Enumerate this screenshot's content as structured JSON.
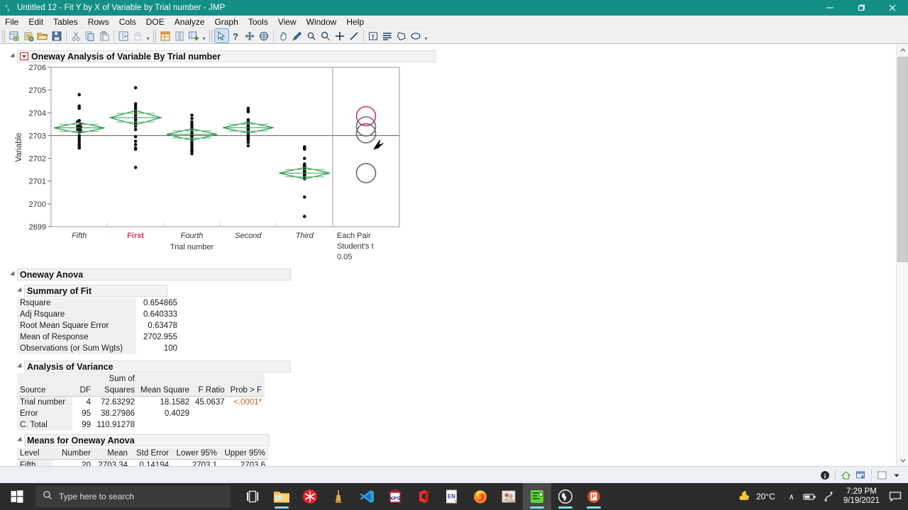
{
  "window": {
    "title": "Untitled 12 - Fit Y by X of Variable by Trial number - JMP",
    "app_icon": "jmp-icon",
    "minimize": "—",
    "maximize": "❐",
    "close": "✕",
    "accent_color": "#148f86"
  },
  "menubar": {
    "items": [
      "File",
      "Edit",
      "Tables",
      "Rows",
      "Cols",
      "DOE",
      "Analyze",
      "Graph",
      "Tools",
      "View",
      "Window",
      "Help"
    ]
  },
  "toolbar": {
    "groups": [
      [
        "new-data-table-icon",
        "new-script-icon",
        "open-icon",
        "save-icon"
      ],
      [
        "cut-icon",
        "copy-icon",
        "paste-icon"
      ],
      [
        "journal-icon",
        "lock-icon"
      ],
      [
        "report-icon",
        "column-icon",
        "add-columns-icon"
      ],
      [
        "arrow-tool-icon",
        "question-tool-icon",
        "crosshair-tool-icon",
        "brush-tool-icon"
      ],
      [
        "hand-tool-icon",
        "magic-wand-icon",
        "magnifier-small-icon",
        "magnifier-icon",
        "crosshairs-icon",
        "line-tool-icon"
      ],
      [
        "text-annotate-icon",
        "simple-shape-icon",
        "polygon-icon",
        "ellipse-icon"
      ]
    ]
  },
  "report": {
    "main_title": "Oneway Analysis of Variable By Trial number",
    "sections": {
      "oneway_anova": "Oneway Anova",
      "summary_of_fit": "Summary of Fit",
      "analysis_of_variance": "Analysis of Variance",
      "means_for_oneway_anova": "Means for Oneway Anova"
    },
    "summary_of_fit": {
      "rows": [
        {
          "label": "Rsquare",
          "value": "0.654865"
        },
        {
          "label": "Adj Rsquare",
          "value": "0.640333"
        },
        {
          "label": "Root Mean Square Error",
          "value": "0.63478"
        },
        {
          "label": "Mean of Response",
          "value": "2702.955"
        },
        {
          "label": "Observations (or Sum Wgts)",
          "value": "100"
        }
      ]
    },
    "analysis_of_variance": {
      "headers": [
        "Source",
        "DF",
        "Sum of Squares",
        "Mean Square",
        "F Ratio",
        "Prob > F"
      ],
      "header_lines": {
        "source": "Source",
        "df": "DF",
        "sum_of": "Sum of",
        "squares": "Squares",
        "mean_square": "Mean Square",
        "f_ratio": "F Ratio",
        "prob_f": "Prob > F"
      },
      "rows": [
        {
          "source": "Trial number",
          "df": "4",
          "ss": "72.63292",
          "ms": "18.1582",
          "f": "45.0637",
          "p": "<.0001*",
          "significant": true
        },
        {
          "source": "Error",
          "df": "95",
          "ss": "38.27986",
          "ms": "0.4029",
          "f": "",
          "p": "",
          "significant": false
        },
        {
          "source": "C. Total",
          "df": "99",
          "ss": "110.91278",
          "ms": "",
          "f": "",
          "p": "",
          "significant": false
        }
      ]
    },
    "means_for_oneway_anova": {
      "headers": [
        "Level",
        "Number",
        "Mean",
        "Std Error",
        "Lower 95%",
        "Upper 95%"
      ],
      "rows": [
        {
          "level": "Fifth",
          "number": "20",
          "mean": "2703.34",
          "std_error": "0.14194",
          "lower": "2703.1",
          "upper": "2703.6"
        }
      ]
    }
  },
  "chart_data": {
    "type": "scatter",
    "title": "Oneway Analysis of Variable By Trial number",
    "xlabel": "Trial number",
    "ylabel": "Variable",
    "ylim": [
      2699,
      2706
    ],
    "yticks": [
      2699,
      2700,
      2701,
      2702,
      2703,
      2704,
      2705,
      2706
    ],
    "grid": false,
    "grand_mean": 2703.0,
    "categories": [
      "Fifth",
      "First",
      "Fourth",
      "Second",
      "Third"
    ],
    "highlighted_category": "First",
    "highlight_color": "#d6336c",
    "diamond_color": "#2e9e4f",
    "comparison_panel": {
      "label_line1": "Each Pair",
      "label_line2": "Student's t",
      "label_line3": "0.05",
      "circles": [
        {
          "center": 2703.85,
          "radius": 0.42,
          "color": "#d6336c"
        },
        {
          "center": 2703.4,
          "radius": 0.42,
          "color": "#6b6b6b"
        },
        {
          "center": 2703.1,
          "radius": 0.42,
          "color": "#6b6b6b"
        },
        {
          "center": 2701.35,
          "radius": 0.42,
          "color": "#6b6b6b"
        }
      ]
    },
    "groups": [
      {
        "name": "Fifth",
        "n": 20,
        "mean": 2703.34,
        "ci_lower": 2703.1,
        "ci_upper": 2703.6,
        "values": [
          2704.8,
          2704.3,
          2704.2,
          2703.65,
          2703.6,
          2703.5,
          2703.45,
          2703.4,
          2703.35,
          2703.3,
          2703.25,
          2703.2,
          2703.15,
          2703.1,
          2703.0,
          2702.9,
          2702.8,
          2702.7,
          2702.6,
          2702.55
        ]
      },
      {
        "name": "First",
        "n": 20,
        "mean": 2703.8,
        "ci_lower": 2703.5,
        "ci_upper": 2704.1,
        "values": [
          2705.1,
          2704.4,
          2704.3,
          2704.2,
          2704.1,
          2704.0,
          2703.9,
          2703.8,
          2703.7,
          2703.6,
          2703.55,
          2703.4,
          2703.25,
          2702.95,
          2702.75,
          2702.6,
          2702.45,
          2702.4,
          2701.6,
          2703.85
        ]
      },
      {
        "name": "Fourth",
        "n": 20,
        "mean": 2703.05,
        "ci_lower": 2702.8,
        "ci_upper": 2703.3,
        "values": [
          2703.9,
          2703.75,
          2703.6,
          2703.5,
          2703.4,
          2703.3,
          2703.2,
          2703.1,
          2703.05,
          2703.0,
          2702.95,
          2702.9,
          2702.8,
          2702.7,
          2702.6,
          2702.5,
          2702.4,
          2702.35,
          2702.3,
          2702.2
        ]
      },
      {
        "name": "Second",
        "n": 20,
        "mean": 2703.35,
        "ci_lower": 2703.1,
        "ci_upper": 2703.6,
        "values": [
          2704.2,
          2704.1,
          2704.05,
          2703.7,
          2703.6,
          2703.5,
          2703.45,
          2703.4,
          2703.35,
          2703.3,
          2703.25,
          2703.2,
          2703.1,
          2703.0,
          2702.95,
          2702.9,
          2702.85,
          2702.8,
          2702.7,
          2702.55
        ]
      },
      {
        "name": "Third",
        "n": 20,
        "mean": 2701.35,
        "ci_lower": 2701.1,
        "ci_upper": 2701.6,
        "values": [
          2702.4,
          2702.35,
          2702.3,
          2701.9,
          2701.65,
          2701.6,
          2701.55,
          2701.5,
          2701.45,
          2701.4,
          2701.35,
          2701.3,
          2701.25,
          2701.2,
          2701.15,
          2701.1,
          2701.05,
          2701.0,
          2700.3,
          2699.45
        ]
      }
    ]
  },
  "statusbar": {
    "items": [
      "info-icon",
      "home-icon",
      "window-icon",
      "blank-box-icon",
      "dropdown-caret-icon"
    ]
  },
  "taskbar": {
    "start": "windows-start-icon",
    "search_placeholder": "Type here to search",
    "search_icon": "search-icon",
    "pinned": [
      "task-view-icon",
      "file-explorer-icon",
      "snowflake-app-icon",
      "statistics-app-icon",
      "vscode-icon",
      "xps-viewer-icon",
      "office-icon",
      "english-ime-icon",
      "firefox-icon",
      "photos-app-icon",
      "jmp-icon",
      "obs-studio-icon",
      "powerpoint-icon"
    ],
    "weather_temp": "20°C",
    "weather_icon": "partly-cloudy-night-icon",
    "chevron": "∧",
    "time": "7:29 PM",
    "date": "9/19/2021",
    "notification_icon": "notification-icon"
  }
}
